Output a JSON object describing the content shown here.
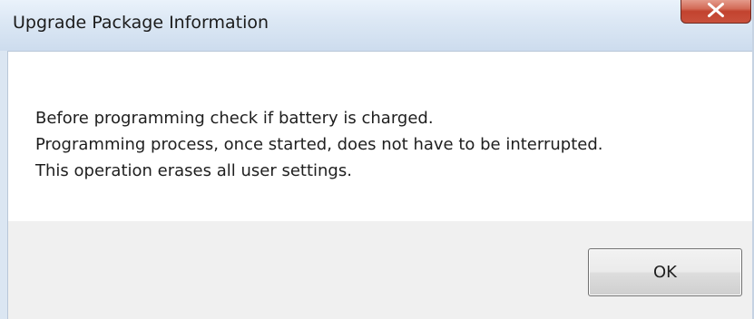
{
  "window": {
    "title": "Upgrade Package Information",
    "close_label": "x"
  },
  "message": {
    "lines": [
      "Before programming check if battery is charged.",
      "Programming process, once started, does not have to be interrupted.",
      "This operation erases all user settings."
    ]
  },
  "buttons": {
    "ok_label": "OK"
  },
  "icons": {
    "close": "close-icon"
  },
  "colors": {
    "titlebar": "#dbe7f4",
    "close_button": "#c9503c",
    "content_background": "#ffffff",
    "button_area_background": "#f0f0f0"
  }
}
